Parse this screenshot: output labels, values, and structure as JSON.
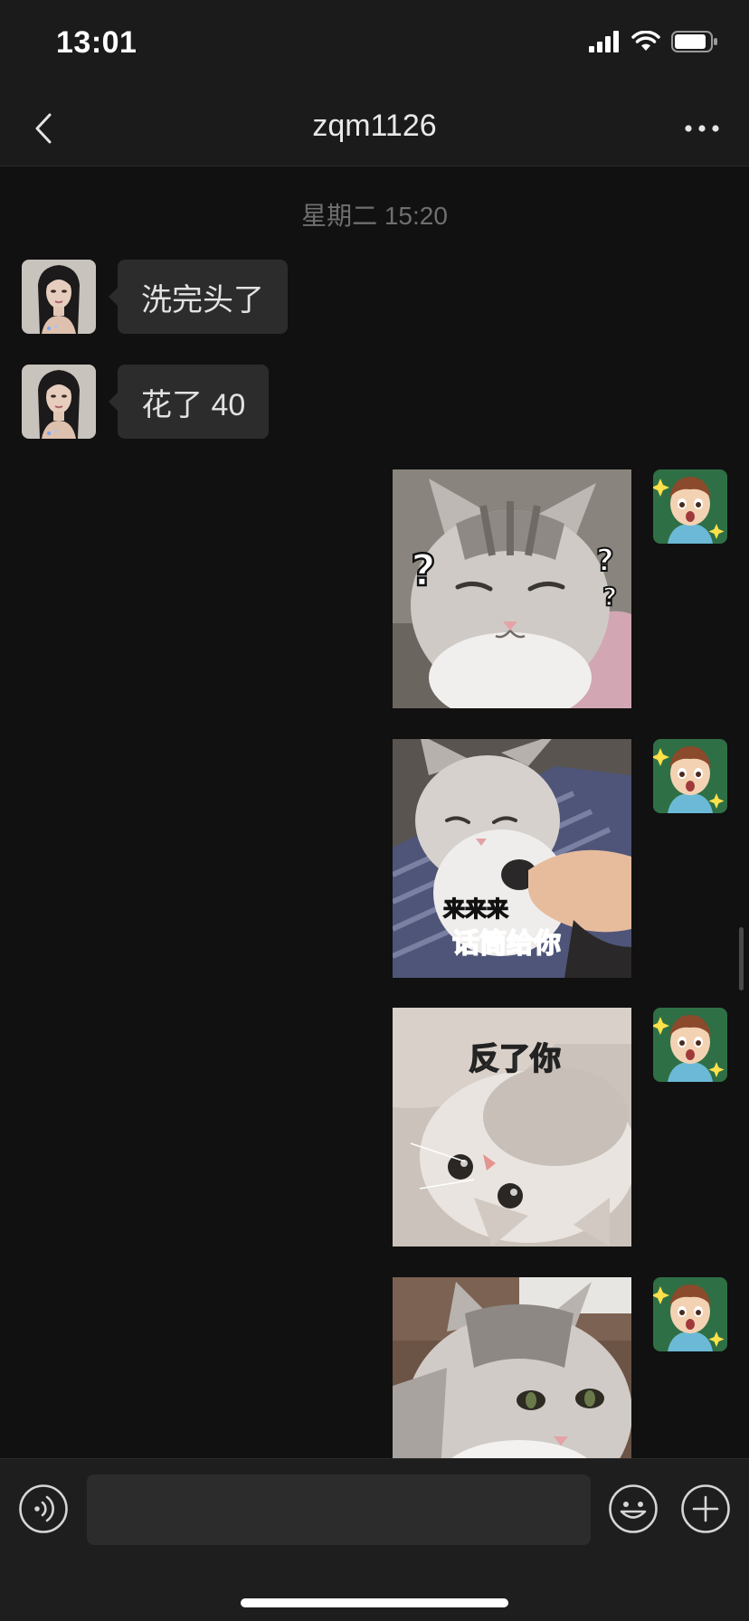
{
  "status_bar": {
    "time": "13:01"
  },
  "header": {
    "title": "zqm1126"
  },
  "chat": {
    "timestamp": "星期二 15:20",
    "messages": [
      {
        "side": "left",
        "type": "text",
        "text": "洗完头了"
      },
      {
        "side": "left",
        "type": "text",
        "text": "花了 40"
      },
      {
        "side": "right",
        "type": "sticker",
        "sticker": "confused-cat"
      },
      {
        "side": "right",
        "type": "sticker",
        "sticker": "microphone-cat",
        "caption_top": "来来来",
        "caption_bottom": "话筒给你"
      },
      {
        "side": "right",
        "type": "sticker",
        "sticker": "upside-down-cat",
        "caption_top": "反了你"
      },
      {
        "side": "right",
        "type": "sticker",
        "sticker": "staring-cat"
      }
    ]
  },
  "input_bar": {
    "placeholder": "",
    "value": ""
  },
  "icons": {
    "back": "chevron-left-icon",
    "more": "ellipsis-icon",
    "voice": "voice-icon",
    "emoji": "smiley-icon",
    "plus": "plus-circle-icon"
  },
  "colors": {
    "background": "#111111",
    "bar": "#1b1b1b",
    "bubble_received": "#2c2c2c",
    "caption_red": "#ff5b4a"
  }
}
